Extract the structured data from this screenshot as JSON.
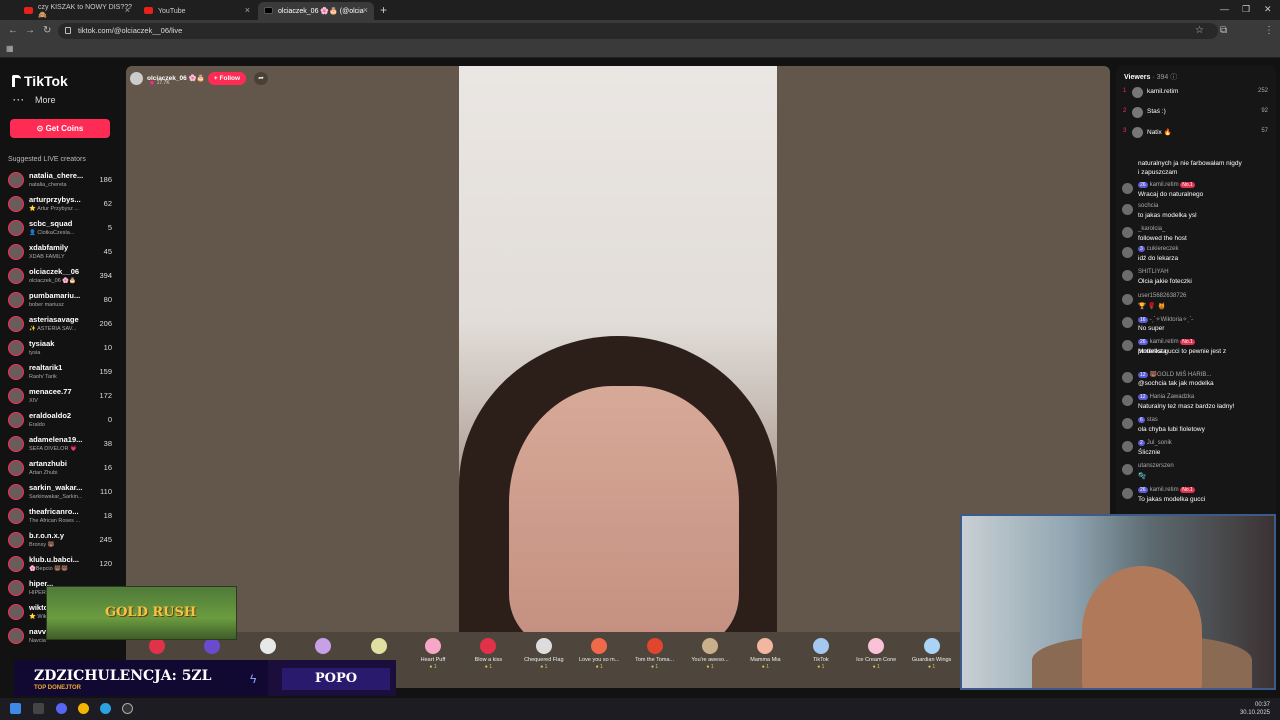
{
  "browser": {
    "tabs": [
      {
        "title": "czy KISZAK to NOWY DIS??? 🙈"
      },
      {
        "title": "YouTube"
      },
      {
        "title": "olciaczek_06 🌸🎂 (@olcia"
      }
    ],
    "new_tab": "+",
    "url": "tiktok.com/@olciaczek__06/live"
  },
  "sidebar": {
    "logo": "TikTok",
    "more": "More",
    "get_coins": "Get Coins",
    "section_title": "Suggested LIVE creators",
    "creators": [
      {
        "name": "natalia_chere...",
        "sub": "natalia_chereta",
        "count": "186"
      },
      {
        "name": "arturprzybys...",
        "sub": "⭐ Artur Przybysz ...",
        "count": "62"
      },
      {
        "name": "scbc_squad",
        "sub": "👤 ClotkaCzesla...",
        "count": "5"
      },
      {
        "name": "xdabfamily",
        "sub": "XDAB FAMILY",
        "count": "45"
      },
      {
        "name": "olciaczek__06",
        "sub": "olciaczek_06 🌸🎂",
        "count": "394"
      },
      {
        "name": "pumbamariu...",
        "sub": "bober mariusz",
        "count": "80"
      },
      {
        "name": "asteriasavage",
        "sub": "✨ ASTERIA SAV...",
        "count": "206"
      },
      {
        "name": "tysiaak",
        "sub": "tysia",
        "count": "10"
      },
      {
        "name": "realtarik1",
        "sub": "Raoh/ Tarik",
        "count": "159"
      },
      {
        "name": "menacee.77",
        "sub": "XIV",
        "count": "172"
      },
      {
        "name": "eraldoaldo2",
        "sub": "Eraldo",
        "count": "0"
      },
      {
        "name": "adamelena19...",
        "sub": "SEFA DIVELOR 💗",
        "count": "38"
      },
      {
        "name": "artanzhubi",
        "sub": "Artan Zhubi",
        "count": "16"
      },
      {
        "name": "sarkin_wakar...",
        "sub": "Sarkinwakar_Sarkin...",
        "count": "110"
      },
      {
        "name": "theafricanro...",
        "sub": "The African Roses ...",
        "count": "18"
      },
      {
        "name": "b.r.o.n.x.y",
        "sub": "Bronxy 🐻",
        "count": "245"
      },
      {
        "name": "klub.u.babci...",
        "sub": "🌸Bepcio 🐻🐻",
        "count": "120"
      },
      {
        "name": "hiper...",
        "sub": "HIPER",
        "count": ""
      },
      {
        "name": "wikto...",
        "sub": "⭐ Wiki",
        "count": ""
      },
      {
        "name": "navv...",
        "sub": "Navcia",
        "count": "160"
      }
    ]
  },
  "stream": {
    "host": "olciaczek_06 🌸🎂",
    "likes": "💗 17.7K",
    "follow": "+ Follow",
    "share_icon": "share-icon",
    "gifts": [
      {
        "name": "Heart Puff",
        "price": "1",
        "color": "#f7a6c8"
      },
      {
        "name": "Blow a kiss",
        "price": "1",
        "color": "#e2324a"
      },
      {
        "name": "Chequered Flag",
        "price": "1",
        "color": "#dddddd"
      },
      {
        "name": "Love you so m...",
        "price": "1",
        "color": "#f06a4a"
      },
      {
        "name": "Tom the Toma...",
        "price": "1",
        "color": "#e0452e"
      },
      {
        "name": "You're aweso...",
        "price": "1",
        "color": "#c9b08a"
      },
      {
        "name": "Mamma Mia",
        "price": "1",
        "color": "#f3b6a0"
      },
      {
        "name": "TikTok",
        "price": "1",
        "color": "#a4c8f0"
      },
      {
        "name": "Ice Cream Cone",
        "price": "1",
        "color": "#f9c2d8"
      },
      {
        "name": "Guardian Wings",
        "price": "1",
        "color": "#a9d4f5"
      }
    ]
  },
  "chat": {
    "title": "Viewers",
    "viewer_count": "· 394",
    "top_viewers": [
      {
        "rank": "1",
        "name": "kamil.retim",
        "score": "252"
      },
      {
        "rank": "2",
        "name": "Staś :)",
        "score": "92"
      },
      {
        "rank": "3",
        "name": "Natix 🔥",
        "score": "57"
      }
    ],
    "messages": [
      {
        "user": "",
        "text": "naturalnych ja nie farbowałam nigdy"
      },
      {
        "user": "",
        "text": "i zapuszczam"
      },
      {
        "user": "kamil.retim",
        "badge": "26",
        "badge2": "No.1",
        "text": "Wracaj do naturalnego"
      },
      {
        "user": "sochcia",
        "text": "to jakas modelka ysl"
      },
      {
        "user": "_karolcia_",
        "text": "followed the host"
      },
      {
        "user": "cukiereczek",
        "badge": "3",
        "text": "idź do lekarza"
      },
      {
        "user": "SHITLIYAH",
        "text": "Olcia jakie foteczki"
      },
      {
        "user": "user15682638726",
        "text": "🏆 🌹 🍯"
      },
      {
        "user": "˗ˏˋ✧Wiktoria✧ˎˊ˗",
        "badge": "16",
        "text": "No super"
      },
      {
        "user": "kamil.retim",
        "badge": "26",
        "badge2": "No.1",
        "text": "Modelka gucci to pewnie jest z"
      },
      {
        "user": "",
        "text": "pinteresta"
      },
      {
        "user": "🐻GOLD MIŚ HARIB...",
        "badge": "12",
        "text": "@sochcia tak jak modelka"
      },
      {
        "user": "Hania Zawadzka",
        "badge": "12",
        "text": "Naturalny też masz bardzo ładny!"
      },
      {
        "user": "stas",
        "badge": "6",
        "text": "ola chyba lubi fioletowy"
      },
      {
        "user": "Jul_sonik",
        "badge": "2",
        "text": "Ślicznie"
      },
      {
        "user": "utanszerszen",
        "text": "🫧"
      },
      {
        "user": "kamil.retim",
        "badge": "26",
        "badge2": "No.1",
        "text": "To jakas modelka gucci"
      }
    ]
  },
  "overlay": {
    "game": "GOLD RUSH",
    "donation_big": "ZDZICHULENCJA: 5ZL",
    "donation_small": "TOP DONEJTOR",
    "donation_right": "POPO"
  },
  "taskbar": {
    "time": "00:37",
    "date": "30.10.2025"
  }
}
